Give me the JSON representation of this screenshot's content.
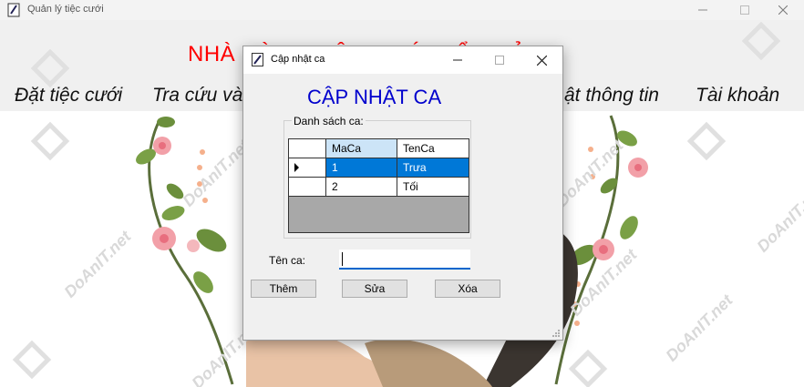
{
  "main_window": {
    "title": "Quản lý tiệc cưới",
    "banner_title": "NHÀ HÀNG TIỆC CƯỚI CẨM BẢO",
    "menu": [
      "Đặt tiệc cưới",
      "Tra cứu và",
      "ật thông tin",
      "Tài khoản"
    ],
    "watermark": "DoAnIT.net"
  },
  "dialog": {
    "title": "Cập nhật ca",
    "heading": "CẬP NHẬT CA",
    "group_label": "Danh sách ca:",
    "grid": {
      "columns": [
        "MaCa",
        "TenCa"
      ],
      "rows": [
        {
          "MaCa": "1",
          "TenCa": "Trưa",
          "selected": true
        },
        {
          "MaCa": "2",
          "TenCa": "Tối",
          "selected": false
        }
      ]
    },
    "name_label": "Tên ca:",
    "name_value": "",
    "buttons": {
      "add": "Thêm",
      "edit": "Sửa",
      "delete": "Xóa"
    }
  },
  "colors": {
    "banner_title": "#ff0000",
    "heading": "#0000cd",
    "selection": "#0078d7",
    "column_header": "#cce4f7"
  }
}
